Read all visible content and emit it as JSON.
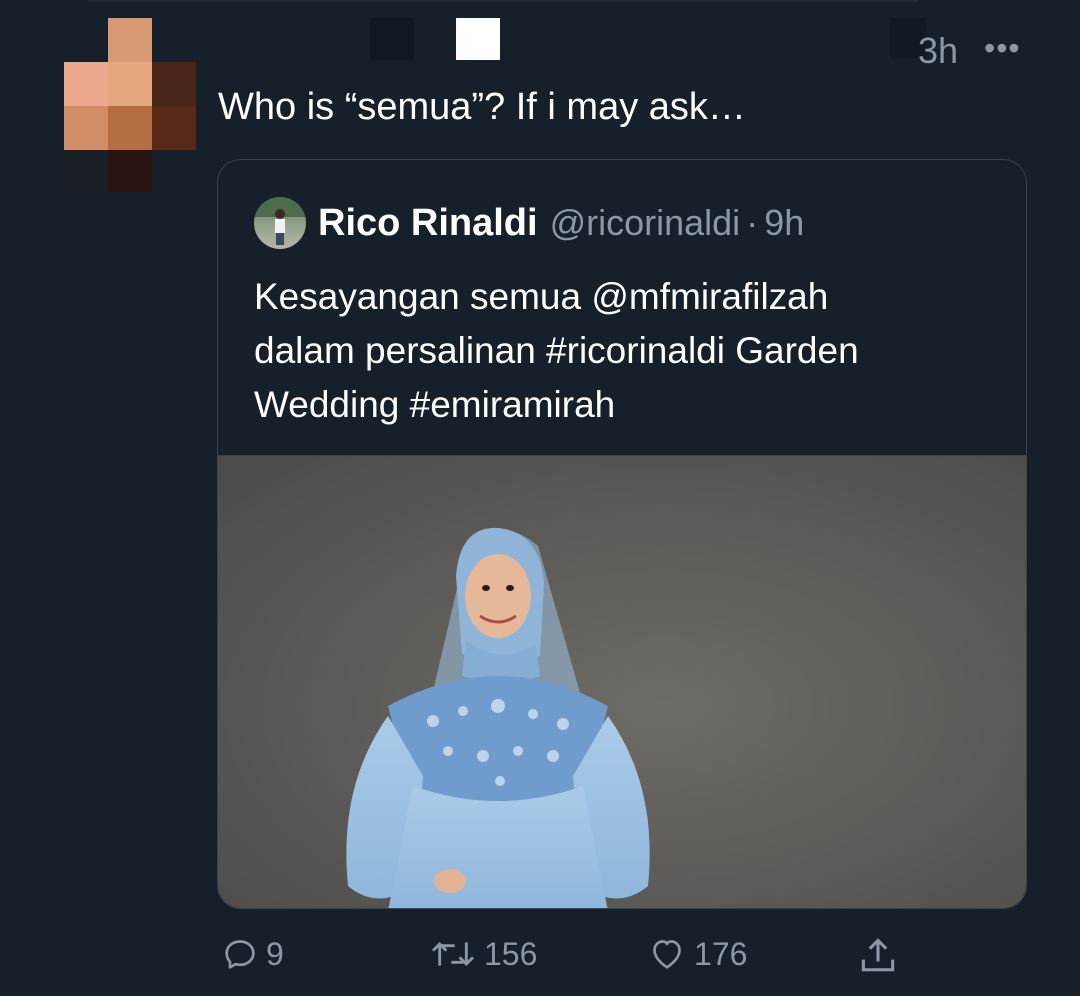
{
  "tweet": {
    "time": "3h",
    "more_glyph": "•••",
    "text": "Who is “semua”? If i may ask…",
    "avatar_icon": "pixelated-avatar-icon"
  },
  "quoted": {
    "name": "Rico Rinaldi",
    "handle": "@ricorinaldi",
    "separator": "·",
    "time": "9h",
    "text_lines": [
      "Kesayangan semua @mfmirafilzah",
      "dalam persalinan #ricorinaldi Garden",
      "Wedding #emiramirah"
    ],
    "media_icon": "photo-woman-blue-hijab-gown"
  },
  "actions": {
    "reply_count": "9",
    "retweet_count": "156",
    "like_count": "176",
    "reply_icon": "reply-icon",
    "retweet_icon": "retweet-icon",
    "like_icon": "heart-icon",
    "share_icon": "share-icon"
  },
  "colors": {
    "background": "#15202b",
    "text": "#ffffff",
    "muted": "#8b98a5",
    "border": "#38444d"
  }
}
